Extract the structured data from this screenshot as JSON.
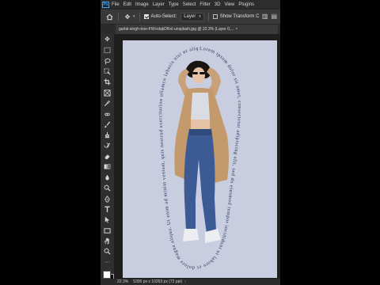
{
  "menubar": {
    "logo": "Ps",
    "items": [
      "File",
      "Edit",
      "Image",
      "Layer",
      "Type",
      "Select",
      "Filter",
      "3D",
      "View",
      "Plugins"
    ]
  },
  "options": {
    "auto_select_label": "Auto-Select:",
    "auto_select_checked": true,
    "auto_select_target": "Layer",
    "show_transform_label": "Show Transform C"
  },
  "document": {
    "tab_title": "gurlal-singh-toor-FWcstqkDRxI-unsplash.jpg @ 22.3% (Layer 0,...",
    "circular_text": "Lorem ipsum dolor sit amet, consectetur adipiscing elit, sed do eiusmod tempor incididunt ut labore et dolore magna aliqua. Ut enim ad minim veniam, quis nostrud exercitation ullamco laboris nisi ut aliquip ex ea commodo viverra maecenas accumsan lacus vel facilisis.",
    "background_color": "#c8cedf",
    "text_color": "#1c2a55"
  },
  "status": {
    "zoom": "22.3%",
    "info": "5300 px x 10263 px (72 ppi)"
  },
  "colors": {
    "foreground": "#ffffff",
    "background": "#000000"
  },
  "tools": [
    "move-tool",
    "marquee-tool",
    "lasso-tool",
    "object-selection-tool",
    "crop-tool",
    "frame-tool",
    "eyedropper-tool",
    "spot-healing-tool",
    "brush-tool",
    "clone-stamp-tool",
    "history-brush-tool",
    "eraser-tool",
    "gradient-tool",
    "blur-tool",
    "dodge-tool",
    "pen-tool",
    "type-tool",
    "path-selection-tool",
    "rectangle-tool",
    "hand-tool",
    "zoom-tool"
  ]
}
